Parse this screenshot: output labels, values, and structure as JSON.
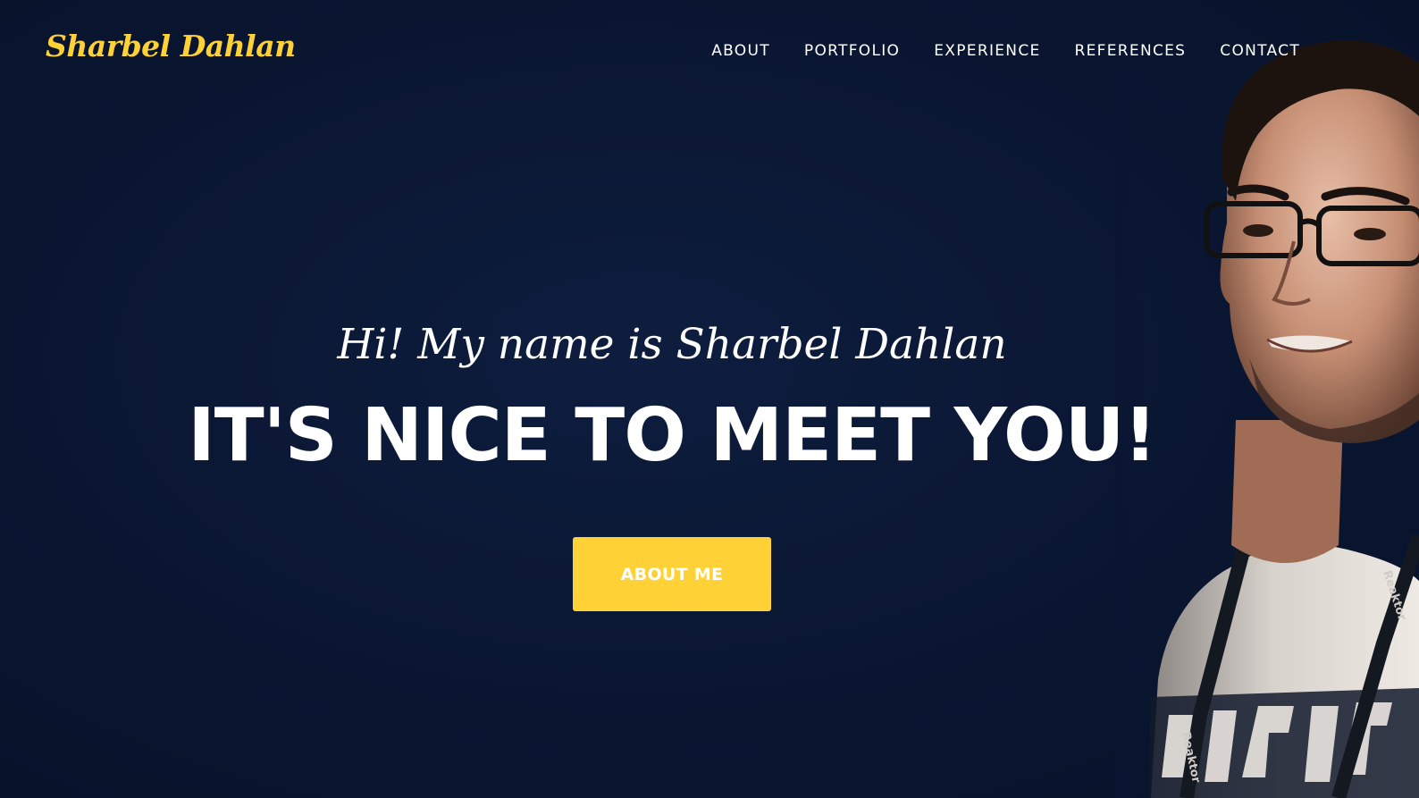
{
  "brand": {
    "name": "Sharbel Dahlan",
    "color": "#fed136"
  },
  "nav": {
    "items": [
      {
        "label": "ABOUT"
      },
      {
        "label": "PORTFOLIO"
      },
      {
        "label": "EXPERIENCE"
      },
      {
        "label": "REFERENCES"
      },
      {
        "label": "CONTACT"
      }
    ]
  },
  "hero": {
    "lead": "Hi! My name is Sharbel Dahlan",
    "heading": "IT'S NICE TO MEET YOU!",
    "button_label": "ABOUT ME",
    "background_color": "#0b1733",
    "accent_color": "#fed136",
    "portrait": {
      "lanyard_text": "Reaktor",
      "lanyard_marker": "R"
    }
  }
}
